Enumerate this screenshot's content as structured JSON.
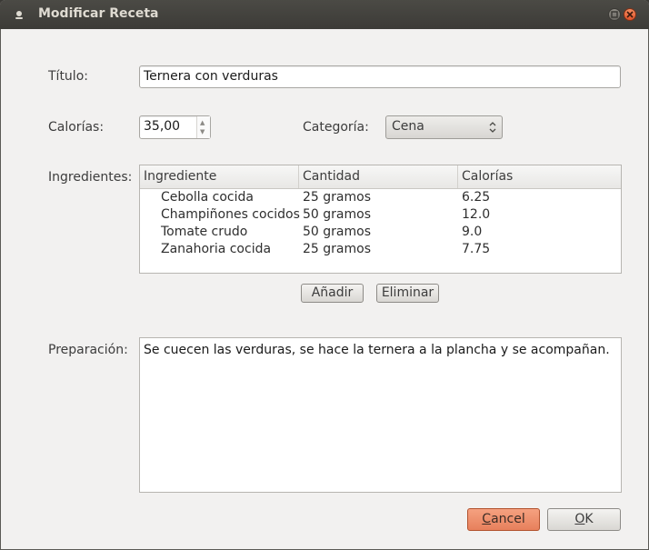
{
  "window": {
    "title": "Modificar Receta"
  },
  "form": {
    "titulo_label": "Título:",
    "titulo_value": "Ternera con verduras",
    "calorias_label": "Calorías:",
    "calorias_value": "35,00",
    "categoria_label": "Categoría:",
    "categoria_value": "Cena",
    "ingredientes_label": "Ingredientes:",
    "preparacion_label": "Preparación:",
    "preparacion_value": "Se cuecen las verduras, se hace la ternera a la plancha y se acompañan."
  },
  "ingredients": {
    "columns": [
      "Ingrediente",
      "Cantidad",
      "Calorías"
    ],
    "rows": [
      [
        "Cebolla cocida",
        "25 gramos",
        "6.25"
      ],
      [
        "Champiñones cocidos",
        "50 gramos",
        "12.0"
      ],
      [
        "Tomate crudo",
        "50 gramos",
        "9.0"
      ],
      [
        "Zanahoria cocida",
        "25 gramos",
        "7.75"
      ]
    ]
  },
  "buttons": {
    "add": "Añadir",
    "remove": "Eliminar",
    "cancel_mnemonic": "C",
    "cancel_rest": "ancel",
    "ok_mnemonic": "O",
    "ok_rest": "K"
  },
  "colors": {
    "titlebar": "#3c3b37",
    "window_bg": "#f2f1f0",
    "cancel_accent": "#e7805c"
  }
}
